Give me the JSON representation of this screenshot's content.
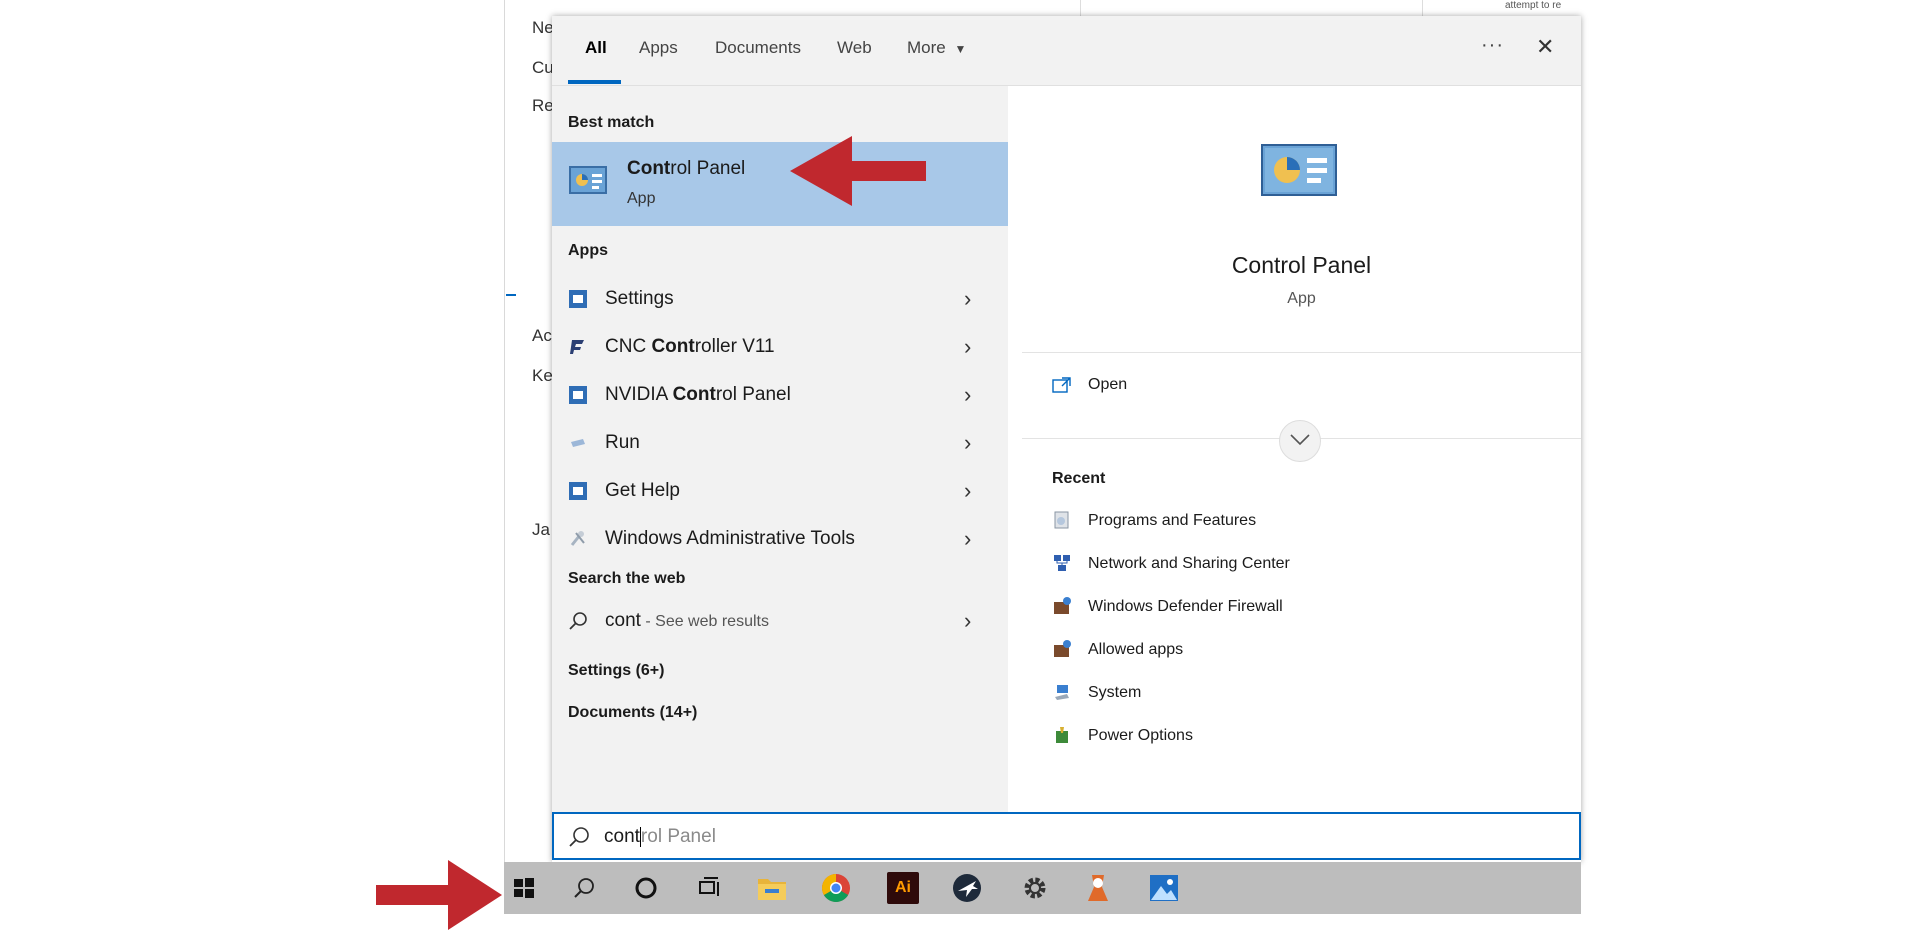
{
  "background_window": {
    "fragments": [
      "Ne",
      "Cu",
      "Re",
      "Ac",
      "Ke",
      "Ja"
    ],
    "corner_text": "attempt to re"
  },
  "tabs": [
    {
      "label": "All",
      "active": true
    },
    {
      "label": "Apps",
      "active": false
    },
    {
      "label": "Documents",
      "active": false
    },
    {
      "label": "Web",
      "active": false
    },
    {
      "label": "More",
      "active": false
    }
  ],
  "more_caret": "▼",
  "ellipsis": "···",
  "close_glyph": "✕",
  "best_match": {
    "header": "Best match",
    "title_bold": "Cont",
    "title_rest": "rol Panel",
    "subtitle": "App"
  },
  "apps": {
    "header": "Apps",
    "items": [
      {
        "pre": "Settings",
        "bold": "",
        "post": "",
        "icon": "settings-app-icon"
      },
      {
        "pre": "CNC ",
        "bold": "Cont",
        "post": "roller V11",
        "icon": "cnc-controller-icon"
      },
      {
        "pre": "NVIDIA ",
        "bold": "Cont",
        "post": "rol Panel",
        "icon": "nvidia-control-panel-icon"
      },
      {
        "pre": "Run",
        "bold": "",
        "post": "",
        "icon": "run-icon"
      },
      {
        "pre": "Get Help",
        "bold": "",
        "post": "",
        "icon": "get-help-icon"
      },
      {
        "pre": "Windows Administrative Tools",
        "bold": "",
        "post": "",
        "icon": "admin-tools-icon"
      }
    ]
  },
  "web": {
    "header": "Search the web",
    "query": "cont",
    "suffix": " - See web results"
  },
  "settings_count": "Settings (6+)",
  "documents_count": "Documents (14+)",
  "chevron": "›",
  "preview": {
    "title": "Control Panel",
    "subtitle": "App",
    "open_label": "Open",
    "recent_header": "Recent",
    "recent": [
      {
        "label": "Programs and Features",
        "icon": "programs-features-icon"
      },
      {
        "label": "Network and Sharing Center",
        "icon": "network-sharing-icon"
      },
      {
        "label": "Windows Defender Firewall",
        "icon": "firewall-icon"
      },
      {
        "label": "Allowed apps",
        "icon": "allowed-apps-icon"
      },
      {
        "label": "System",
        "icon": "system-icon"
      },
      {
        "label": "Power Options",
        "icon": "power-options-icon"
      }
    ]
  },
  "search": {
    "typed": "cont",
    "completion": "rol Panel"
  },
  "taskbar": {
    "icons": [
      "start-icon",
      "search-icon",
      "cortana-icon",
      "task-view-icon",
      "file-explorer-icon",
      "chrome-icon",
      "illustrator-icon",
      "xplane-icon",
      "settings-gear-icon",
      "app-icon",
      "photos-icon"
    ],
    "illustrator_label": "Ai"
  },
  "colors": {
    "accent": "#0067c0",
    "best_match_bg": "#a8c8e8",
    "annotation_arrow": "#c0282e"
  }
}
